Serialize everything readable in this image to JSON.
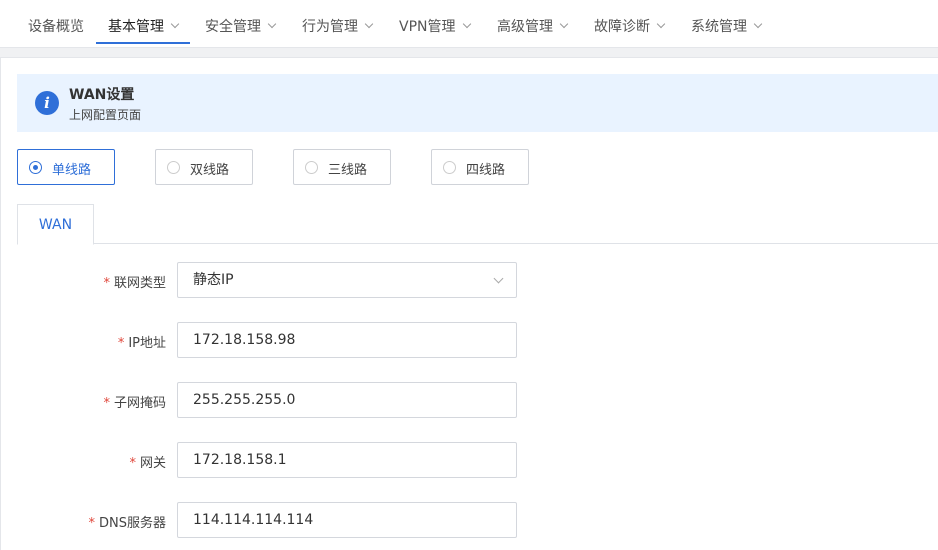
{
  "nav": {
    "items": [
      {
        "label": "设备概览",
        "has_dropdown": false,
        "active": false
      },
      {
        "label": "基本管理",
        "has_dropdown": true,
        "active": true
      },
      {
        "label": "安全管理",
        "has_dropdown": true,
        "active": false
      },
      {
        "label": "行为管理",
        "has_dropdown": true,
        "active": false
      },
      {
        "label": "VPN管理",
        "has_dropdown": true,
        "active": false
      },
      {
        "label": "高级管理",
        "has_dropdown": true,
        "active": false
      },
      {
        "label": "故障诊断",
        "has_dropdown": true,
        "active": false
      },
      {
        "label": "系统管理",
        "has_dropdown": true,
        "active": false
      }
    ]
  },
  "banner": {
    "icon": "info-icon",
    "icon_glyph": "i",
    "title": "WAN设置",
    "subtitle": "上网配置页面"
  },
  "line_options": [
    {
      "label": "单线路",
      "selected": true
    },
    {
      "label": "双线路",
      "selected": false
    },
    {
      "label": "三线路",
      "selected": false
    },
    {
      "label": "四线路",
      "selected": false
    }
  ],
  "tabs": [
    {
      "label": "WAN",
      "active": true
    }
  ],
  "form": {
    "required_mark": "*",
    "connection_type": {
      "label": "联网类型",
      "value": "静态IP"
    },
    "ip_address": {
      "label": "IP地址",
      "value": "172.18.158.98"
    },
    "subnet_mask": {
      "label": "子网掩码",
      "value": "255.255.255.0"
    },
    "gateway": {
      "label": "网关",
      "value": "172.18.158.1"
    },
    "dns_server": {
      "label": "DNS服务器",
      "value": "114.114.114.114"
    }
  },
  "colors": {
    "accent": "#2f6fd8",
    "banner_bg": "#e9f3ff",
    "required": "#e0463a"
  }
}
